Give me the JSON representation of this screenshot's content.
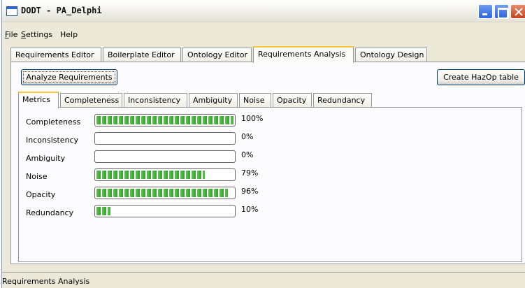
{
  "window": {
    "title": "DODT - PA_Delphi"
  },
  "menu": [
    {
      "label": "File"
    },
    {
      "label": "Settings"
    },
    {
      "label": "Help"
    }
  ],
  "outer_tabs": [
    {
      "label": "Requirements Editor"
    },
    {
      "label": "Boilerplate Editor"
    },
    {
      "label": "Ontology Editor"
    },
    {
      "label": "Requirements Analysis"
    },
    {
      "label": "Ontology Design"
    }
  ],
  "active_outer_tab": "Requirements Analysis",
  "toolbar": {
    "analyze_label": "Analyze Requirements",
    "hazop_label": "Create HazOp table"
  },
  "inner_tabs": [
    {
      "label": "Metrics"
    },
    {
      "label": "Completeness"
    },
    {
      "label": "Inconsistency"
    },
    {
      "label": "Ambiguity"
    },
    {
      "label": "Noise"
    },
    {
      "label": "Opacity"
    },
    {
      "label": "Redundancy"
    }
  ],
  "active_inner_tab": "Metrics",
  "metrics": [
    {
      "label": "Completeness",
      "value": 1.0,
      "text": "100%"
    },
    {
      "label": "Inconsistency",
      "value": 0.0,
      "text": "0%"
    },
    {
      "label": "Ambiguity",
      "value": 0.0,
      "text": "0%"
    },
    {
      "label": "Noise",
      "value": 0.79,
      "text": "79%"
    },
    {
      "label": "Opacity",
      "value": 0.96,
      "text": "96%"
    },
    {
      "label": "Redundancy",
      "value": 0.1,
      "text": "10%"
    }
  ],
  "status": {
    "text": "Requirements Analysis"
  },
  "colors": {
    "accent": "#ffc83c",
    "progress": "#34a02c",
    "titlebar_button": "#2c62e0",
    "close_button": "#c9411c"
  }
}
